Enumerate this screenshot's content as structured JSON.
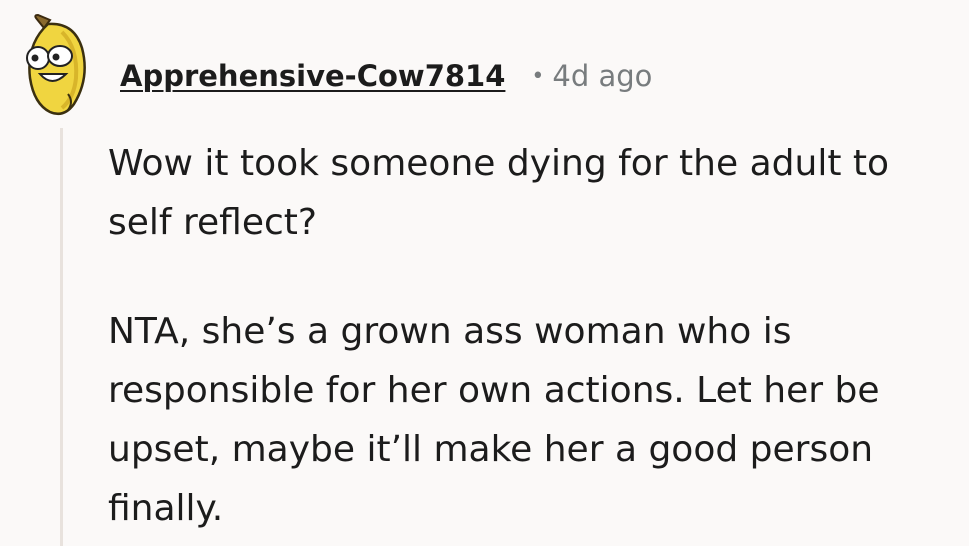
{
  "comment": {
    "username": "Apprehensive-Cow7814",
    "separator": "•",
    "timestamp": "4d ago",
    "avatar_icon": "banana-snoo-avatar",
    "paragraphs": [
      "Wow it took someone dying for the adult to self reflect?",
      "NTA, she’s a grown ass woman who is responsible for her own actions. Let her be upset, maybe it’ll make her a good person finally."
    ]
  },
  "colors": {
    "background": "#fbf9f8",
    "text": "#1c1c1c",
    "meta": "#787c7e",
    "thread_line": "#e8e2dd",
    "avatar_yellow": "#f0d540"
  }
}
